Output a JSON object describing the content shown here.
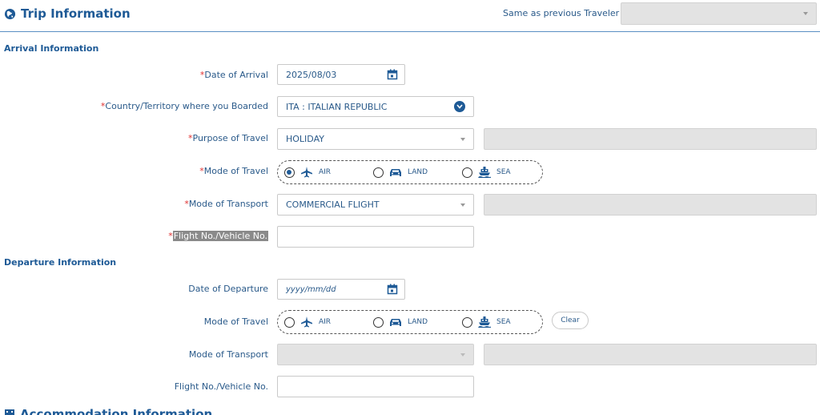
{
  "header": {
    "title": "Trip Information",
    "same_as_previous_label": "Same as previous Traveler",
    "same_as_previous_value": ""
  },
  "arrival": {
    "section_title": "Arrival Information",
    "date_label": "Date of Arrival",
    "date_value": "2025/08/03",
    "country_label": "Country/Territory where you Boarded",
    "country_value": "ITA : ITALIAN REPUBLIC",
    "purpose_label": "Purpose of Travel",
    "purpose_value": "HOLIDAY",
    "purpose_other_value": "",
    "mode_label": "Mode of Travel",
    "mode_options": [
      "AIR",
      "LAND",
      "SEA"
    ],
    "mode_selected": "AIR",
    "transport_label": "Mode of Transport",
    "transport_value": "COMMERCIAL FLIGHT",
    "transport_other_value": "",
    "flight_label": "Flight No./Vehicle No.",
    "flight_value": ""
  },
  "departure": {
    "section_title": "Departure Information",
    "date_label": "Date of Departure",
    "date_placeholder": "yyyy/mm/dd",
    "mode_label": "Mode of Travel",
    "mode_options": [
      "AIR",
      "LAND",
      "SEA"
    ],
    "clear_label": "Clear",
    "transport_label": "Mode of Transport",
    "transport_value": "",
    "flight_label": "Flight No./Vehicle No.",
    "flight_value": ""
  },
  "footer": {
    "next_section_title": "Accommodation Information"
  },
  "colors": {
    "primary": "#1e5a96",
    "required": "#e03030",
    "disabled": "#e3e3e3"
  }
}
